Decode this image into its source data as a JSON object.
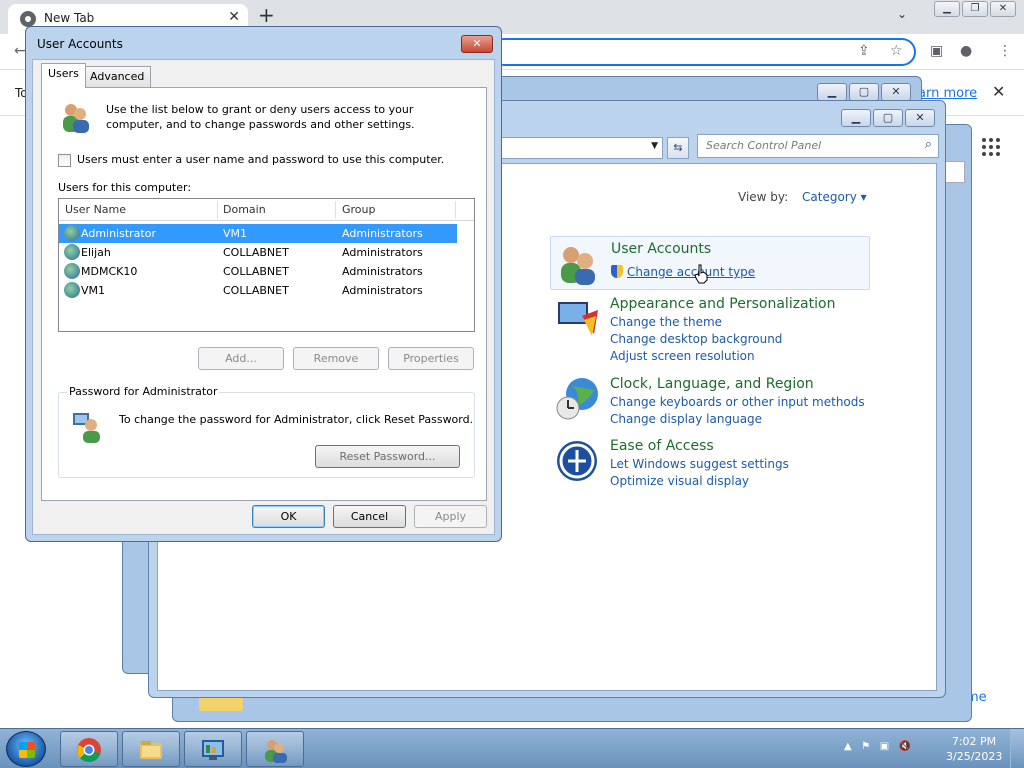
{
  "browser": {
    "tab_title": "New Tab",
    "tab_close": "✕",
    "new_tab": "+",
    "infobar_text": "To",
    "infobar_link": "arn more",
    "infobar_close": "✕",
    "home_link": "me"
  },
  "control_panel": {
    "search_placeholder": "Search Control Panel",
    "view_by_label": "View by:",
    "view_by_value": "Category",
    "categories": [
      {
        "title": "User Accounts",
        "links": [
          "Change account type"
        ]
      },
      {
        "title": "Appearance and Personalization",
        "links": [
          "Change the theme",
          "Change desktop background",
          "Adjust screen resolution"
        ]
      },
      {
        "title": "Clock, Language, and Region",
        "links": [
          "Change keyboards or other input methods",
          "Change display language"
        ]
      },
      {
        "title": "Ease of Access",
        "links": [
          "Let Windows suggest settings",
          "Optimize visual display"
        ]
      }
    ]
  },
  "dialog": {
    "title": "User Accounts",
    "close": "✕",
    "tabs": [
      "Users",
      "Advanced"
    ],
    "intro": "Use the list below to grant or deny users access to your computer, and to change passwords and other settings.",
    "checkbox_label": "Users must enter a user name and password to use this computer.",
    "users_label": "Users for this computer:",
    "columns": [
      "User Name",
      "Domain",
      "Group"
    ],
    "rows": [
      {
        "name": "Administrator",
        "domain": "VM1",
        "group": "Administrators",
        "selected": true
      },
      {
        "name": "Elijah",
        "domain": "COLLABNET",
        "group": "Administrators"
      },
      {
        "name": "MDMCK10",
        "domain": "COLLABNET",
        "group": "Administrators"
      },
      {
        "name": "VM1",
        "domain": "COLLABNET",
        "group": "Administrators"
      }
    ],
    "add_button": "Add...",
    "remove_button": "Remove",
    "properties_button": "Properties",
    "password_group_title": "Password for Administrator",
    "password_text": "To change the password for Administrator, click Reset Password.",
    "reset_button": "Reset Password...",
    "ok_button": "OK",
    "cancel_button": "Cancel",
    "apply_button": "Apply"
  },
  "taskbar": {
    "time": "7:02 PM",
    "date": "3/25/2023"
  },
  "colors": {
    "selection": "#3399ff",
    "category_title": "#1e6b2e",
    "link": "#1e5aa6"
  }
}
